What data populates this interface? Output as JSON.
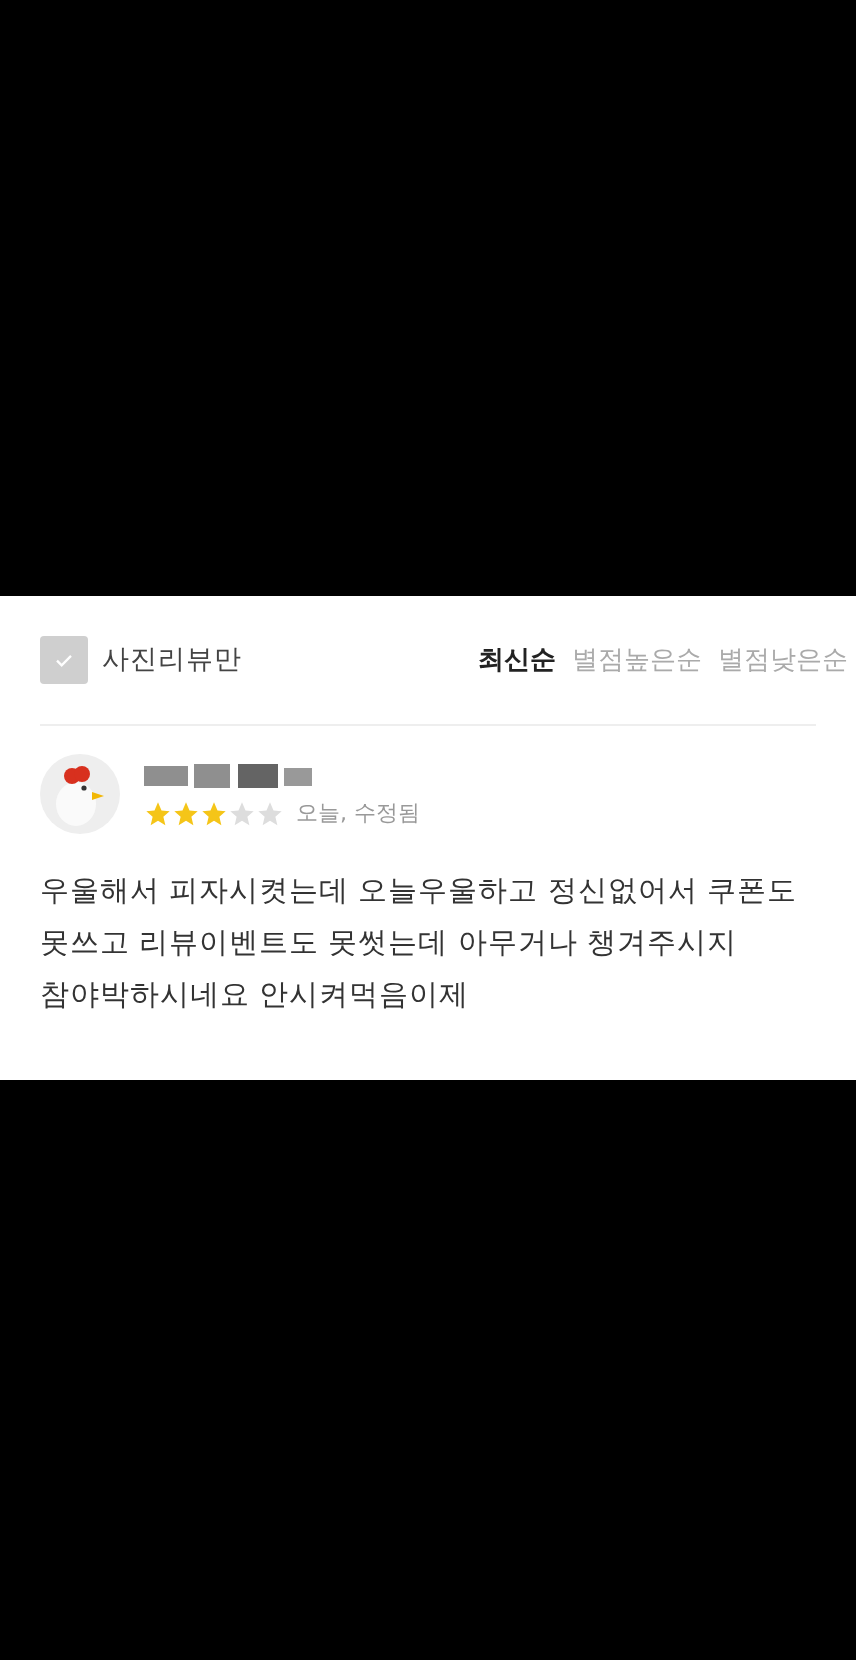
{
  "filter": {
    "label": "사진리뷰만",
    "checked": false
  },
  "sort_tabs": [
    {
      "label": "최신순",
      "selected": true
    },
    {
      "label": "별점높은순",
      "selected": false
    },
    {
      "label": "별점낮은순",
      "selected": false
    }
  ],
  "review": {
    "stars": 3,
    "meta": "오늘, 수정됨",
    "text": "우울해서 피자시켯는데 오늘우울하고 정신없어서 쿠폰도 못쓰고 리뷰이벤트도 못썻는데 아무거나 챙겨주시지 참야박하시네요 안시켜먹음이제"
  }
}
